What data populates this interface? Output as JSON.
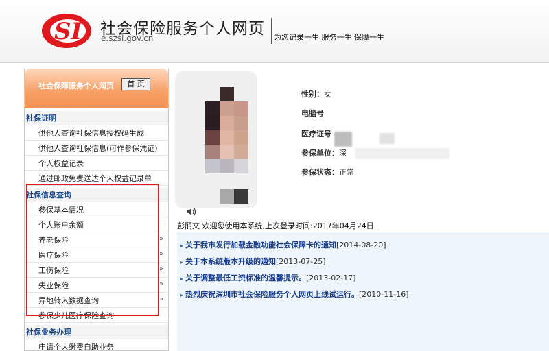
{
  "header": {
    "title": "社会保险服务个人网页",
    "url": "e.szsi.gov.cn",
    "slogan": "为您记录一生 服务一生 保障一生",
    "logo_text": "SI"
  },
  "sidebar": {
    "header_title": "社会保障服务个人网页",
    "home_button": "首 页",
    "sections": [
      {
        "title": "社保证明",
        "items": [
          {
            "label": "供他人查询社保信息授权码生成"
          },
          {
            "label": "供他人查询社保信息(可作参保凭证)"
          },
          {
            "label": "个人权益记录"
          },
          {
            "label": "通过邮政免费送达个人权益记录单"
          }
        ]
      },
      {
        "title": "社保信息查询",
        "items": [
          {
            "label": "参保基本情况"
          },
          {
            "label": "个人账户余额"
          },
          {
            "label": "养老保险"
          },
          {
            "label": "医疗保险"
          },
          {
            "label": "工伤保险"
          },
          {
            "label": "失业保险"
          },
          {
            "label": "异地转入数据查询"
          },
          {
            "label": "参保少儿医疗保险查询"
          }
        ]
      },
      {
        "title": "社保业务办理",
        "items": [
          {
            "label": "申请个人缴费自助业务"
          }
        ]
      }
    ],
    "chevron": "»"
  },
  "profile": {
    "gender_label": "性别：",
    "gender_value": "女",
    "computer_no_label": "电脑号",
    "medical_card_label": "医疗证号",
    "employer_label": "参保单位：",
    "employer_value": "深",
    "status_label": "参保状态：",
    "status_value": "正常"
  },
  "welcome": {
    "text": "彭丽文 欢迎您使用本系统,上次登录时间:2017年04月24日."
  },
  "news": [
    {
      "title": "关于我市发行加载金融功能社会保障卡的通知",
      "date": "[2014-08-20]"
    },
    {
      "title": "关于本系统版本升级的通知",
      "date": "[2013-07-25]"
    },
    {
      "title": "关于调整最低工资标准的温馨提示。",
      "date": "[2013-02-17]"
    },
    {
      "title": "热烈庆祝深圳市社会保险服务个人网页上线试运行。",
      "date": "[2010-11-16]"
    }
  ],
  "colors": {
    "brand_red": "#e0191f",
    "sidebar_header": "#f4914f",
    "link_blue": "#1b3f8f"
  }
}
